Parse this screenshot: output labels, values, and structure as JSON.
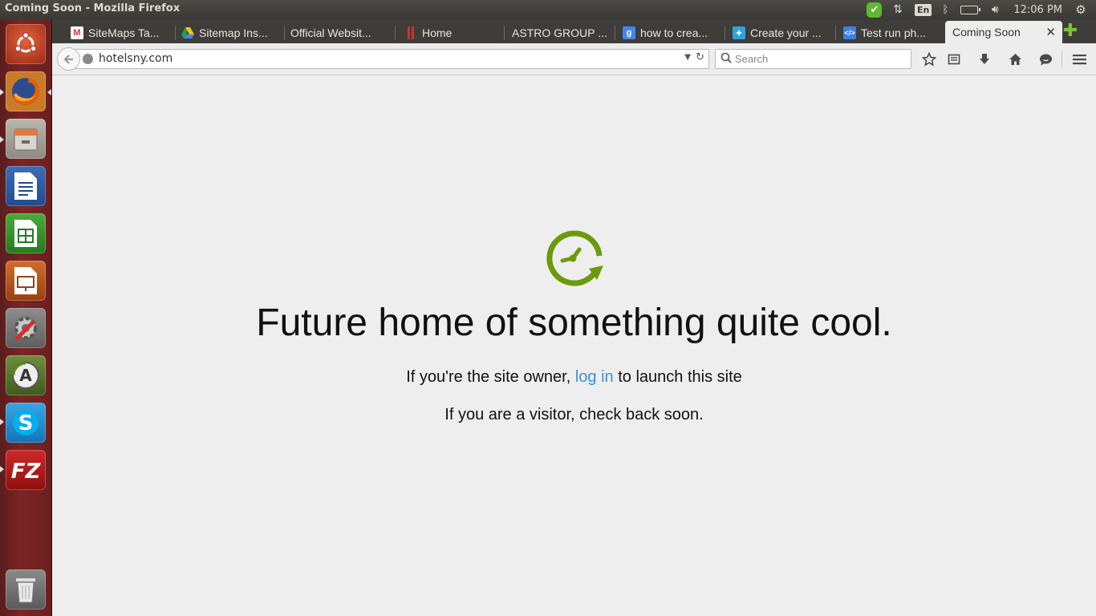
{
  "window": {
    "title": "Coming Soon - Mozilla Firefox"
  },
  "tray": {
    "language": "En",
    "clock": "12:06 PM"
  },
  "launcher": {
    "items": [
      {
        "name": "ubuntu-dash"
      },
      {
        "name": "firefox"
      },
      {
        "name": "files"
      },
      {
        "name": "libreoffice-writer"
      },
      {
        "name": "libreoffice-calc"
      },
      {
        "name": "libreoffice-impress"
      },
      {
        "name": "system-settings"
      },
      {
        "name": "software-updater"
      },
      {
        "name": "skype"
      },
      {
        "name": "filezilla"
      },
      {
        "name": "trash"
      }
    ]
  },
  "tabs": [
    {
      "label": "SiteMaps Ta...",
      "icon": "gmail-icon"
    },
    {
      "label": "Sitemap Ins...",
      "icon": "google-drive-icon"
    },
    {
      "label": "Official Websit...",
      "icon": "none"
    },
    {
      "label": "Home",
      "icon": "bars-icon"
    },
    {
      "label": "ASTRO GROUP ...",
      "icon": "none"
    },
    {
      "label": "how to crea...",
      "icon": "google-icon"
    },
    {
      "label": "Create your ...",
      "icon": "sitebuilder-icon"
    },
    {
      "label": "Test run ph...",
      "icon": "code-icon"
    },
    {
      "label": "Coming Soon",
      "icon": "none",
      "active": true
    }
  ],
  "navbar": {
    "url": "hotelsny.com",
    "search_placeholder": "Search"
  },
  "page": {
    "heading": "Future home of something quite cool.",
    "owner_prefix": "If you're the site owner, ",
    "owner_link": "log in",
    "owner_suffix": " to launch this site",
    "visitor_text": "If you are a visitor, check back soon."
  },
  "colors": {
    "accent_green": "#6b9a0a",
    "link_blue": "#3b8fd6",
    "launcher_bg": "#7b2424"
  }
}
